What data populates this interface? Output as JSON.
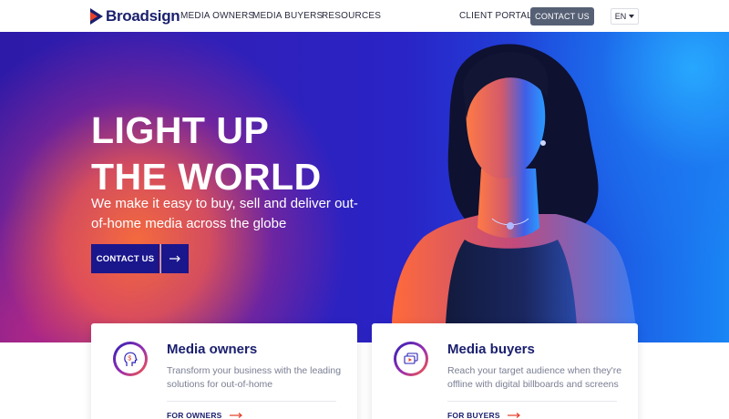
{
  "brand": {
    "name": "Broadsign"
  },
  "nav": {
    "links": [
      "MEDIA OWNERS",
      "MEDIA BUYERS",
      "RESOURCES"
    ],
    "client_portal": "CLIENT PORTAL",
    "contact": "CONTACT US",
    "language": "EN"
  },
  "hero": {
    "title_line1": "LIGHT UP",
    "title_line2": "THE WORLD",
    "subtitle": "We make it easy to buy, sell and deliver out-of-home media across the globe",
    "cta_label": "CONTACT US"
  },
  "cards": [
    {
      "title": "Media owners",
      "description": "Transform your business with the leading solutions for out-of-home",
      "link": "FOR OWNERS",
      "icon": "dollar-head-icon"
    },
    {
      "title": "Media buyers",
      "description": "Reach your target audience when they're offline with digital billboards and screens",
      "link": "FOR BUYERS",
      "icon": "media-screens-icon"
    }
  ],
  "colors": {
    "brand_navy": "#1a1f6e",
    "cta_blue": "#1a168c",
    "accent_red": "#e8412c",
    "nav_button": "#566075"
  }
}
